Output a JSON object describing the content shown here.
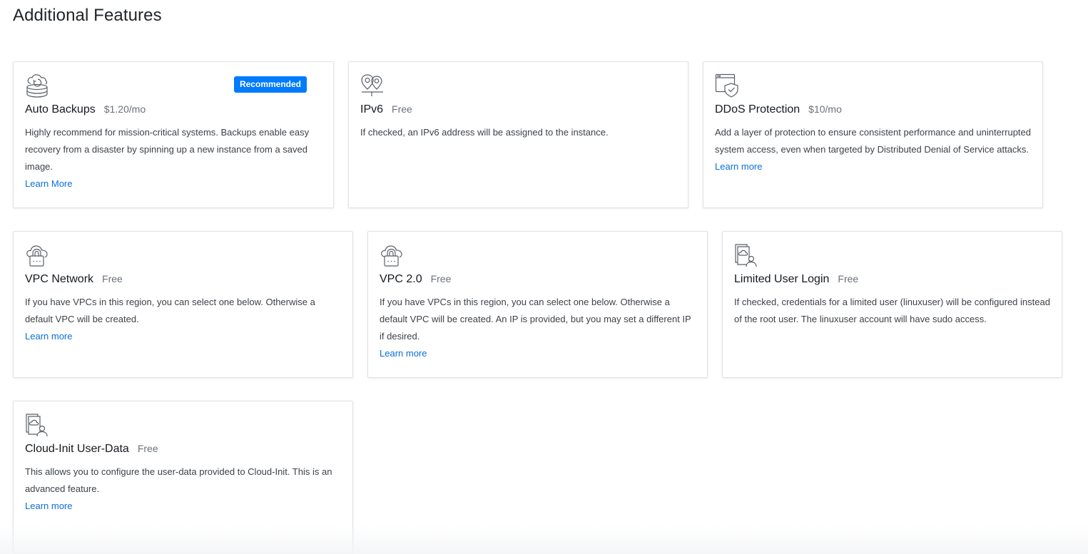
{
  "page": {
    "title": "Additional Features"
  },
  "features": [
    {
      "icon": "backup-icon",
      "title": "Auto Backups",
      "price": "$1.20/mo",
      "badge": "Recommended",
      "description": "Highly recommend for mission-critical systems. Backups enable easy recovery from a disaster by spinning up a new instance from a saved image.",
      "link": "Learn More"
    },
    {
      "icon": "location-pin-icon",
      "title": "IPv6",
      "price": "Free",
      "description": "If checked, an IPv6 address will be assigned to the instance."
    },
    {
      "icon": "shield-window-icon",
      "title": "DDoS Protection",
      "price": "$10/mo",
      "description": "Add a layer of protection to ensure consistent performance and uninterrupted system access, even when targeted by Distributed Denial of Service attacks.",
      "link": "Learn more"
    },
    {
      "icon": "cloud-lock-icon",
      "title": "VPC Network",
      "price": "Free",
      "description": "If you have VPCs in this region, you can select one below. Otherwise a default VPC will be created.",
      "link": "Learn more"
    },
    {
      "icon": "cloud-lock-icon",
      "title": "VPC 2.0",
      "price": "Free",
      "description": "If you have VPCs in this region, you can select one below. Otherwise a default VPC will be created. An IP is provided, but you may set a different IP if desired.",
      "link": "Learn more"
    },
    {
      "icon": "user-document-icon",
      "title": "Limited User Login",
      "price": "Free",
      "description": "If checked, credentials for a limited user (linuxuser) will be configured instead of the root user. The linuxuser account will have sudo access."
    },
    {
      "icon": "user-document-icon",
      "title": "Cloud-Init User-Data",
      "price": "Free",
      "description": "This allows you to configure the user-data provided to Cloud-Init. This is an advanced feature.",
      "link": "Learn more"
    }
  ],
  "colors": {
    "accent": "#007bfc",
    "link": "#0a6fd8",
    "border": "#dfe2e6",
    "muted": "#6b7179"
  }
}
